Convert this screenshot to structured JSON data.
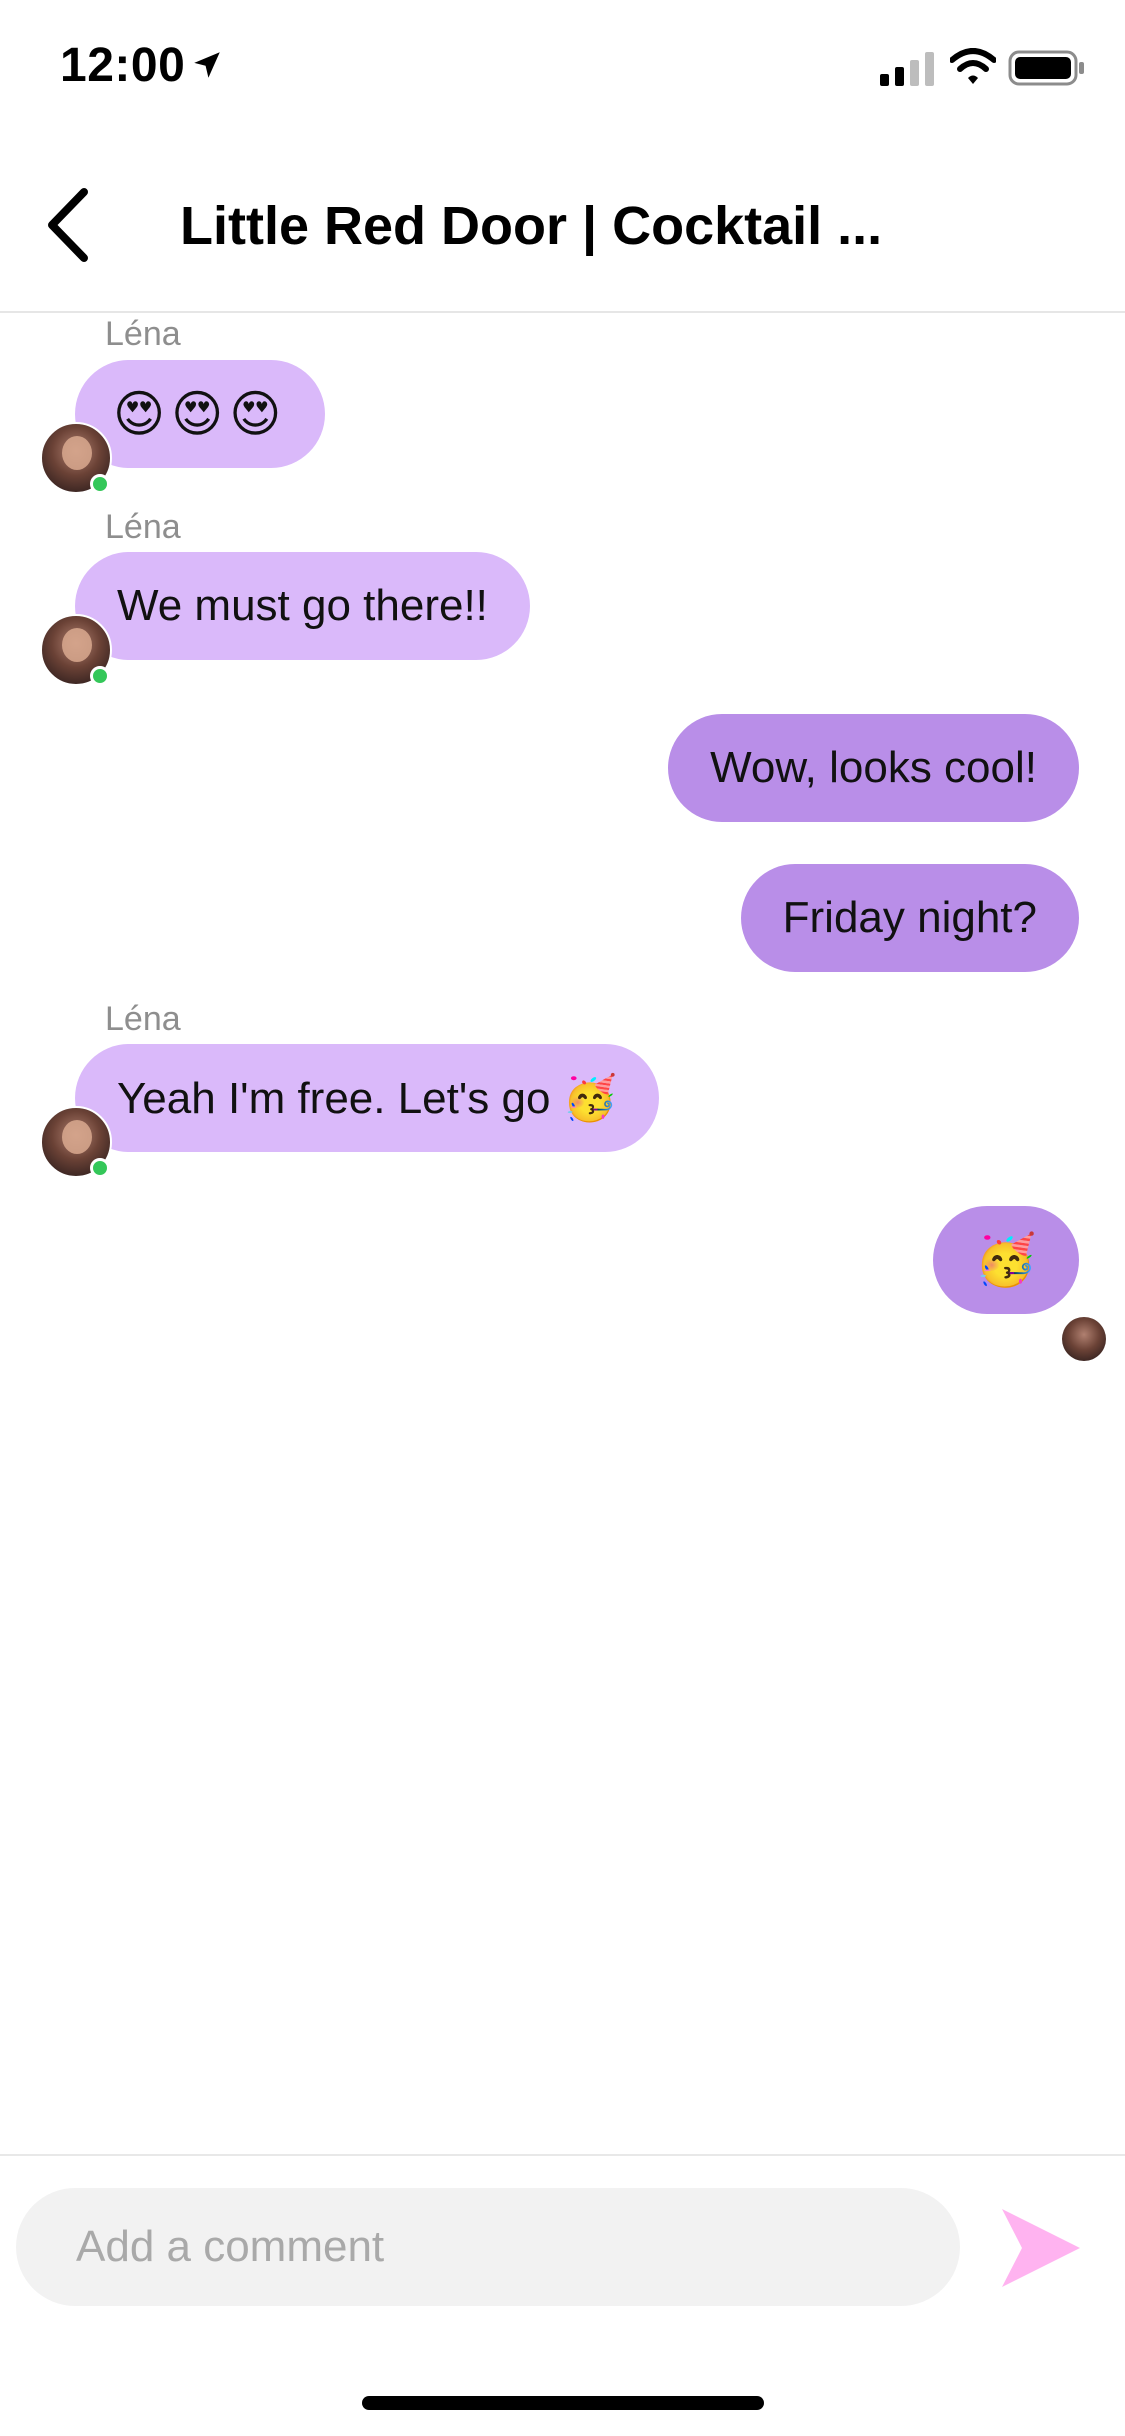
{
  "status_bar": {
    "time": "12:00",
    "icons": [
      "location-arrow-icon",
      "cellular-signal-icon",
      "wifi-icon",
      "battery-icon"
    ]
  },
  "header": {
    "back_icon": "chevron-left-icon",
    "title": "Little Red Door | Cocktail ..."
  },
  "messages": [
    {
      "direction": "incoming",
      "sender": "Léna",
      "text": "😍😍😍",
      "online": true
    },
    {
      "direction": "incoming",
      "sender": "Léna",
      "text": "We must go there!!",
      "online": true
    },
    {
      "direction": "outgoing",
      "text": "Wow, looks cool!"
    },
    {
      "direction": "outgoing",
      "text": "Friday night?"
    },
    {
      "direction": "incoming",
      "sender": "Léna",
      "text": "Yeah I'm free. Let's go 🥳",
      "online": true
    },
    {
      "direction": "outgoing",
      "text": "🥳"
    }
  ],
  "composer": {
    "placeholder": "Add a comment",
    "send_icon": "send-arrow-icon"
  },
  "colors": {
    "incoming_bubble": "#dab9fa",
    "outgoing_bubble": "#b98ee8",
    "online_dot": "#34c759",
    "send_icon": "#ffb3f0"
  }
}
